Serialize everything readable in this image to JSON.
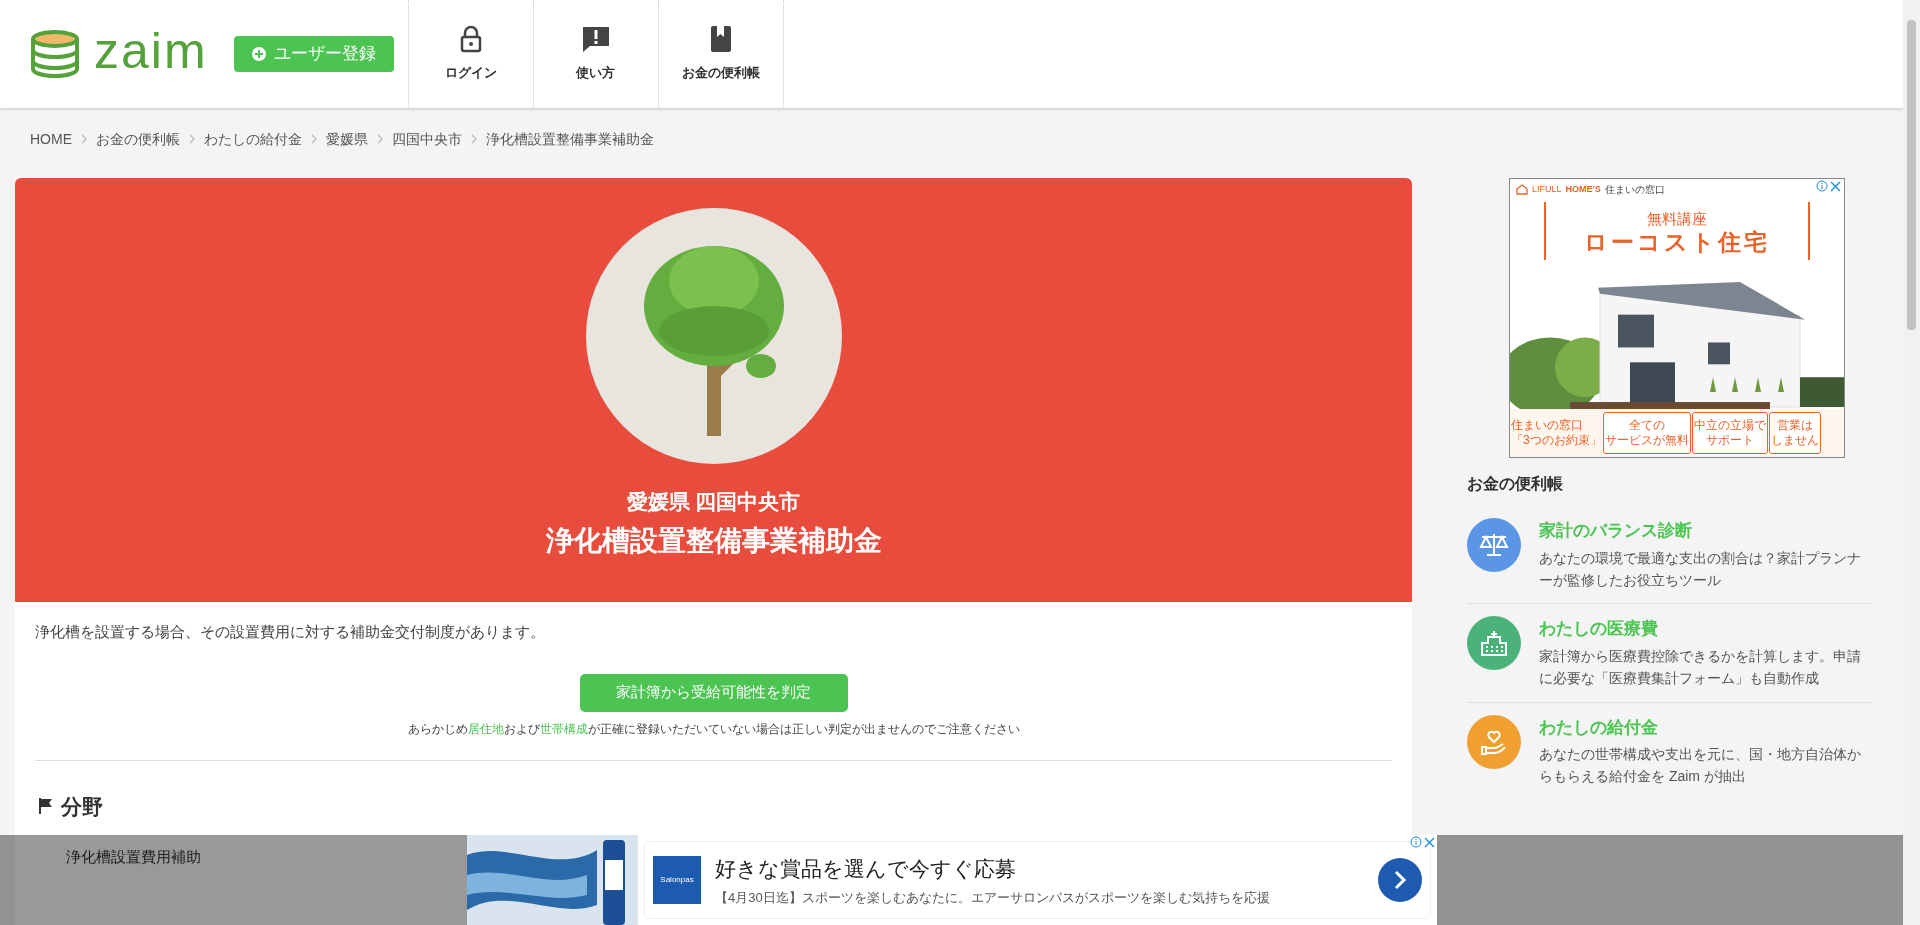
{
  "header": {
    "logo": "zaim",
    "register_button": "ユーザー登録",
    "nav": [
      {
        "label": "ログイン"
      },
      {
        "label": "使い方"
      },
      {
        "label": "お金の便利帳"
      }
    ]
  },
  "breadcrumb": [
    "HOME",
    "お金の便利帳",
    "わたしの給付金",
    "愛媛県",
    "四国中央市",
    "浄化槽設置整備事業補助金"
  ],
  "hero": {
    "location": "愛媛県 四国中央市",
    "title": "浄化槽設置整備事業補助金"
  },
  "description": "浄化槽を設置する場合、その設置費用に対する補助金交付制度があります。",
  "check_button": "家計簿から受給可能性を判定",
  "note": [
    "あらかじめ",
    "居住地",
    "および",
    "世帯構成",
    "が正確に登録いただいていない場合は正しい判定が出ませんのでご注意ください"
  ],
  "sections": [
    {
      "heading": "分野",
      "value": "浄化槽設置費用補助"
    }
  ],
  "side_ad": {
    "brand_small": "LIFULL",
    "brand": "HOME'S",
    "brand_sub": "住まいの窓口",
    "kicker": "無料講座",
    "headline": "ローコスト住宅",
    "footer_title": "住まいの窓口",
    "footer_promise": "「3つのお約束」",
    "points": [
      [
        "全ての",
        "サービスが無料"
      ],
      [
        "中立の立場で",
        "サポート"
      ],
      [
        "営業は",
        "しません"
      ]
    ]
  },
  "sidebar": {
    "title": "お金の便利帳",
    "items": [
      {
        "title": "家計のバランス診断",
        "text": "あなたの環境で最適な支出の割合は？家計プランナーが監修したお役立ちツール",
        "color": "#5b95e6"
      },
      {
        "title": "わたしの医療費",
        "text": "家計簿から医療費控除できるかを計算します。申請に必要な「医療費集計フォーム」も自動作成",
        "color": "#4bb37a"
      },
      {
        "title": "わたしの給付金",
        "text": "あなたの世帯構成や支出を元に、国・地方自治体からもらえる給付金を Zaim が抽出",
        "color": "#f0a030"
      }
    ]
  },
  "bottom_ad": {
    "logo": "Salonpas",
    "headline": "好きな賞品を選んで今すぐ応募",
    "text": "【4月30日迄】スポーツを楽しむあなたに。エアーサロンパスがスポーツを楽しむ気持ちを応援"
  }
}
